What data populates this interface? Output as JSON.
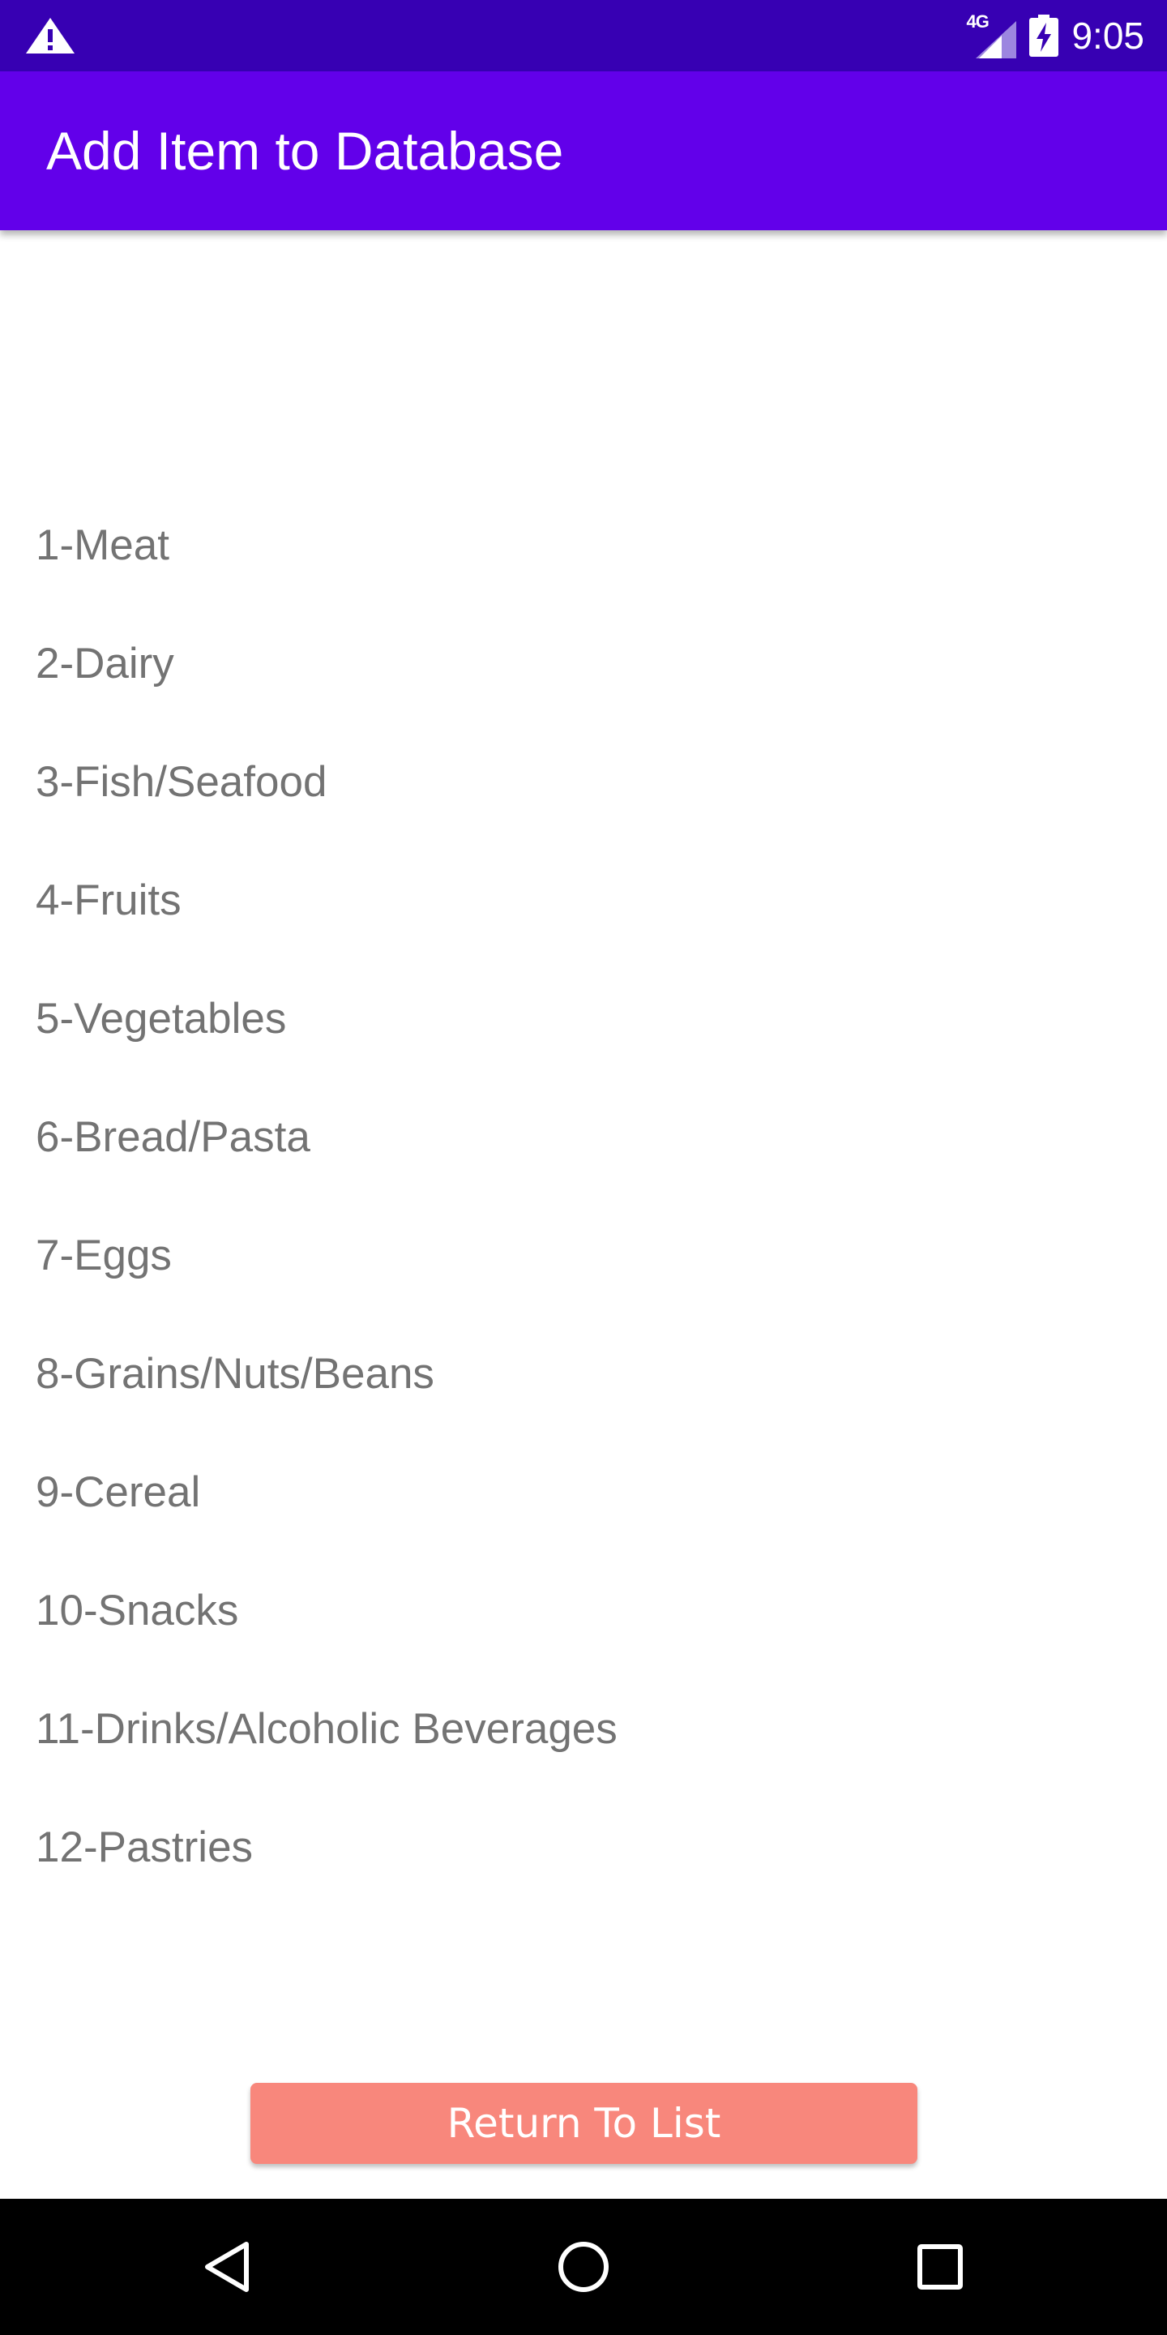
{
  "status_bar": {
    "network_type": "4G",
    "time": "9:05",
    "icons": [
      "warning-icon",
      "signal-icon",
      "battery-charging-icon"
    ],
    "background_color": "#3700b3"
  },
  "app_bar": {
    "title": "Add Item to Database",
    "background_color": "#6200ea"
  },
  "categories": [
    "1-Meat",
    "2-Dairy",
    "3-Fish/Seafood",
    "4-Fruits",
    "5-Vegetables",
    "6-Bread/Pasta",
    "7-Eggs",
    "8-Grains/Nuts/Beans",
    "9-Cereal",
    "10-Snacks",
    "11-Drinks/Alcoholic Beverages",
    "12-Pastries"
  ],
  "return_button": {
    "label": "Return To List",
    "background_color": "#f8877c"
  },
  "nav_bar": {
    "icons": [
      "back-icon",
      "home-icon",
      "recent-apps-icon"
    ]
  }
}
